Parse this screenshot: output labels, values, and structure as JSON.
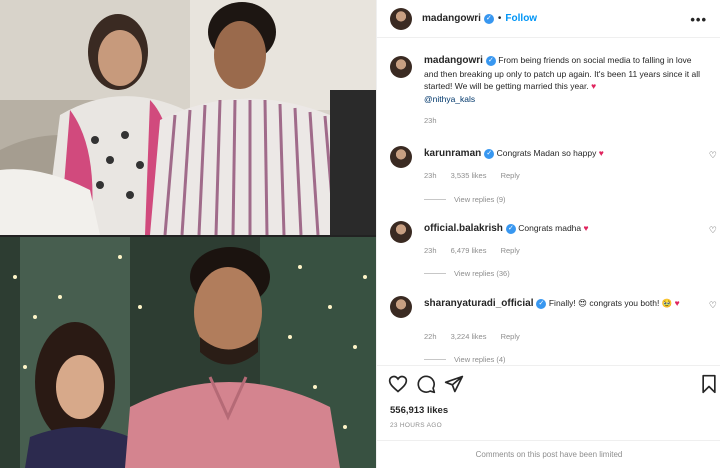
{
  "post": {
    "username": "madangowri",
    "follow_label": "Follow",
    "separator": "•",
    "more": "•••",
    "caption_user": "madangowri",
    "caption_text": "From being friends on social media to falling in love and then breaking up only to patch up again. It's been 11 years since it all started! We will be getting married this year.",
    "caption_mention": "@nithya_kals",
    "caption_time": "23h",
    "likes": "556,913 likes",
    "time_ago": "23 HOURS AGO",
    "comments_limited": "Comments on this post have been limited"
  },
  "comments": [
    {
      "user": "karunraman",
      "text": "Congrats Madan so happy",
      "time": "23h",
      "likes": "3,535 likes",
      "reply": "Reply",
      "view_replies": "View replies (9)"
    },
    {
      "user": "official.balakrish",
      "text": "Congrats madha",
      "time": "23h",
      "likes": "6,479 likes",
      "reply": "Reply",
      "view_replies": "View replies (36)"
    },
    {
      "user": "sharanyaturadi_official",
      "text": "Finally! 😍 congrats you both! 🥹",
      "time": "22h",
      "likes": "3,224 likes",
      "reply": "Reply",
      "view_replies": "View replies (4)"
    }
  ],
  "icons": {
    "heart": "♥",
    "verified": "✓",
    "like": "♡"
  },
  "colors": {
    "follow_blue": "#0095f6",
    "verified_blue": "#3897f0",
    "heart_red": "#e0245e"
  }
}
